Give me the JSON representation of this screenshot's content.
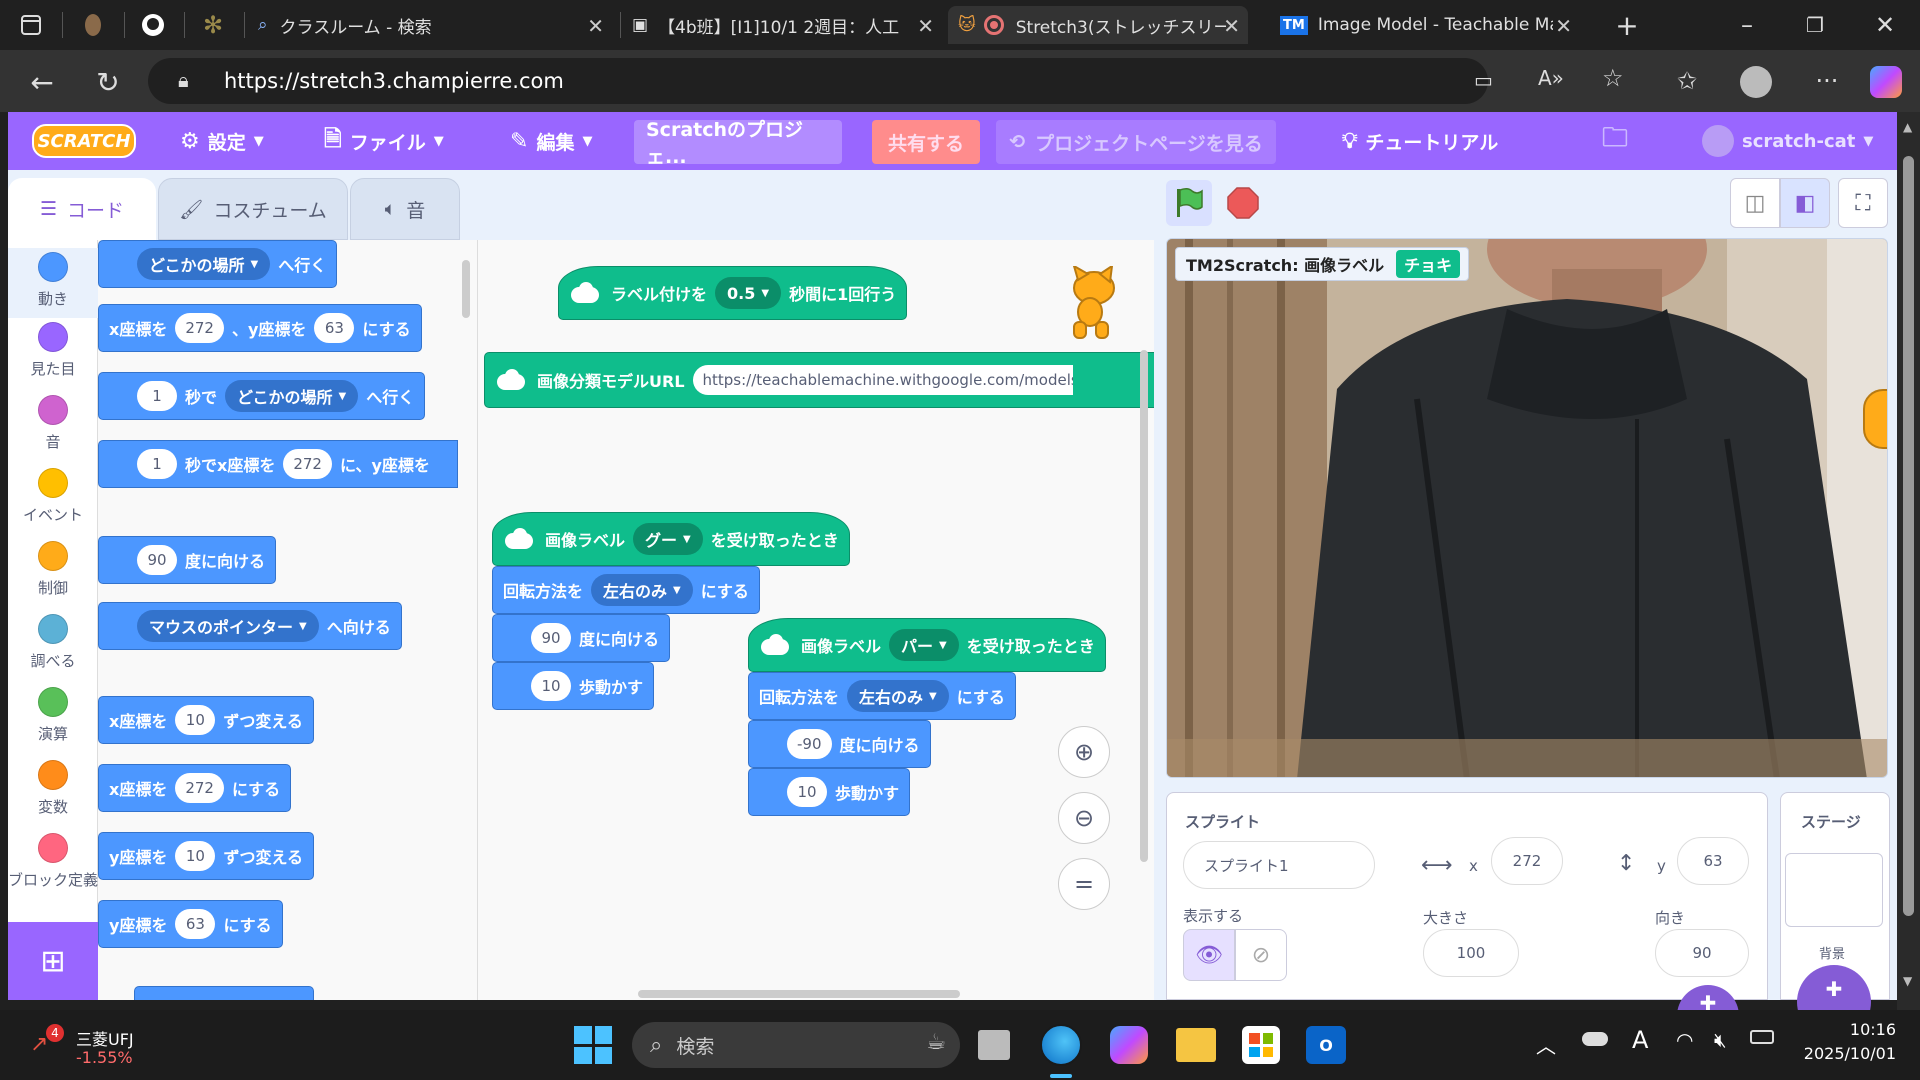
{
  "browser": {
    "tabs": [
      {
        "title": "クラスルーム - 検索"
      },
      {
        "title": "【4b班】[I1]10/1 2週目：人工"
      },
      {
        "title": "Stretch3(ストレッチスリー)"
      },
      {
        "title": "Image Model - Teachable Ma"
      }
    ],
    "url": "https://stretch3.champierre.com"
  },
  "menu": {
    "logo": "SCRATCH",
    "settings": "設定",
    "file": "ファイル",
    "edit": "編集",
    "project_title": "Scratchのプロジェ...",
    "share": "共有する",
    "see_project_page": "プロジェクトページを見る",
    "tutorials": "チュートリアル",
    "username": "scratch-cat"
  },
  "editor_tabs": {
    "code": "コード",
    "costumes": "コスチューム",
    "sounds": "音"
  },
  "categories": [
    {
      "label": "動き",
      "color": "#4c97ff"
    },
    {
      "label": "見た目",
      "color": "#9966ff"
    },
    {
      "label": "音",
      "color": "#cf63cf"
    },
    {
      "label": "イベント",
      "color": "#ffbf00"
    },
    {
      "label": "制御",
      "color": "#ffab19"
    },
    {
      "label": "調べる",
      "color": "#5cb1d6"
    },
    {
      "label": "演算",
      "color": "#59c059"
    },
    {
      "label": "変数",
      "color": "#ff8c1a"
    },
    {
      "label": "ブロック定義",
      "color": "#ff6680"
    }
  ],
  "palette": {
    "goto_dd": "どこかの場所",
    "goto_suffix": "へ行く",
    "setxy_a": "x座標を",
    "setxy_x": "272",
    "setxy_b": "、y座標を",
    "setxy_y": "63",
    "setxy_c": "にする",
    "glide_secs": "1",
    "glide_a": "秒で",
    "glide_dd": "どこかの場所",
    "glide_b": "へ行く",
    "glidexy_secs": "1",
    "glidexy_a": "秒でx座標を",
    "glidexy_x": "272",
    "glidexy_b": "に、y座標を",
    "point_val": "90",
    "point_suffix": "度に向ける",
    "towards_dd": "マウスのポインター",
    "towards_suffix": "へ向ける",
    "changex_a": "x座標を",
    "changex_val": "10",
    "changex_b": "ずつ変える",
    "setx_a": "x座標を",
    "setx_val": "272",
    "setx_b": "にする",
    "changey_a": "y座標を",
    "changey_val": "10",
    "changey_b": "ずつ変える",
    "sety_a": "y座標を",
    "sety_val": "63",
    "sety_b": "にする"
  },
  "script": {
    "label_every_a": "ラベル付けを",
    "label_every_val": "0.5",
    "label_every_b": "秒間に1回行う",
    "model_url_label": "画像分類モデルURL",
    "model_url": "https://teachablemachine.withgoogle.com/models/CxHJnUnw",
    "hat1_a": "画像ラベル",
    "hat1_dd": "グー",
    "hat1_b": "を受け取ったとき",
    "rot1_a": "回転方法を",
    "rot1_dd": "左右のみ",
    "rot1_b": "にする",
    "point1_val": "90",
    "point1_b": "度に向ける",
    "move1_val": "10",
    "move1_b": "歩動かす",
    "hat2_a": "画像ラベル",
    "hat2_dd": "パー",
    "hat2_b": "を受け取ったとき",
    "rot2_a": "回転方法を",
    "rot2_dd": "左右のみ",
    "rot2_b": "にする",
    "point2_val": "-90",
    "point2_b": "度に向ける",
    "move2_val": "10",
    "move2_b": "歩動かす"
  },
  "stage": {
    "monitor_label": "TM2Scratch: 画像ラベル",
    "monitor_value": "チョキ"
  },
  "sprite_info": {
    "header": "スプライト",
    "name": "スプライト1",
    "x_label": "x",
    "x": "272",
    "y_label": "y",
    "y": "63",
    "show_label": "表示する",
    "size_label": "大きさ",
    "size": "100",
    "direction_label": "向き",
    "direction": "90"
  },
  "stage_panel": {
    "title": "ステージ",
    "backdrops_label": "背景"
  },
  "taskbar": {
    "stock_name": "三菱UFJ",
    "stock_change": "-1.55%",
    "stock_badge": "4",
    "search_placeholder": "検索",
    "time": "10:16",
    "date": "2025/10/01"
  }
}
